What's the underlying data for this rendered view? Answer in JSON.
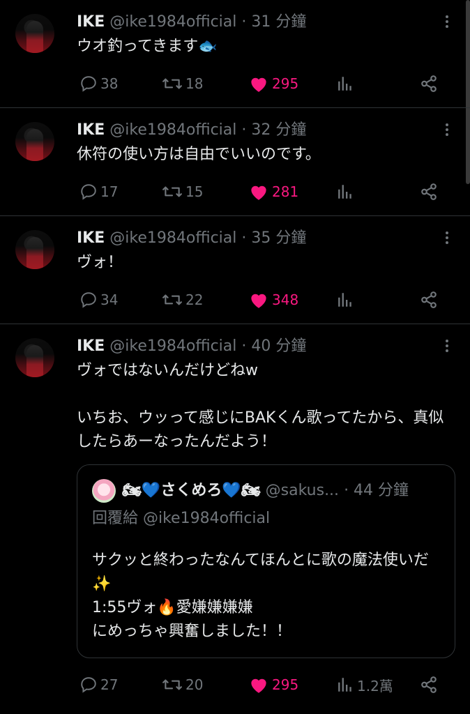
{
  "tweets": [
    {
      "name": "IKE",
      "handle": "@ike1984official",
      "time": "· 31 分鐘",
      "text": "ウオ釣ってきます🐟",
      "replies": "38",
      "retweets": "18",
      "likes": "295",
      "views": ""
    },
    {
      "name": "IKE",
      "handle": "@ike1984official",
      "time": "· 32 分鐘",
      "text": "休符の使い方は自由でいいのです。",
      "replies": "17",
      "retweets": "15",
      "likes": "281",
      "views": ""
    },
    {
      "name": "IKE",
      "handle": "@ike1984official",
      "time": "· 35 分鐘",
      "text": "ヴォ！",
      "replies": "34",
      "retweets": "22",
      "likes": "348",
      "views": ""
    },
    {
      "name": "IKE",
      "handle": "@ike1984official",
      "time": "· 40 分鐘",
      "text": "ヴォではないんだけどねw\n\nいちお、ウッって感じにBAKくん歌ってたから、真似したらあーなったんだよう！",
      "replies": "27",
      "retweets": "20",
      "likes": "295",
      "views": "1.2萬"
    }
  ],
  "quote": {
    "name": "🏍💙さくめろ💙🏍",
    "handle": "@sakus...",
    "time": "· 44 分鐘",
    "reply_to": "回覆給 @ike1984official",
    "text": "サクッと終わったなんてほんとに歌の魔法使いだ✨\n1:55ヴォ🔥愛嫌嫌嫌嫌\nにめっちゃ興奮しました！！"
  },
  "colors": {
    "like": "#f91880",
    "muted": "#71767b",
    "text": "#e7e9ea",
    "divider": "#2f3336"
  }
}
